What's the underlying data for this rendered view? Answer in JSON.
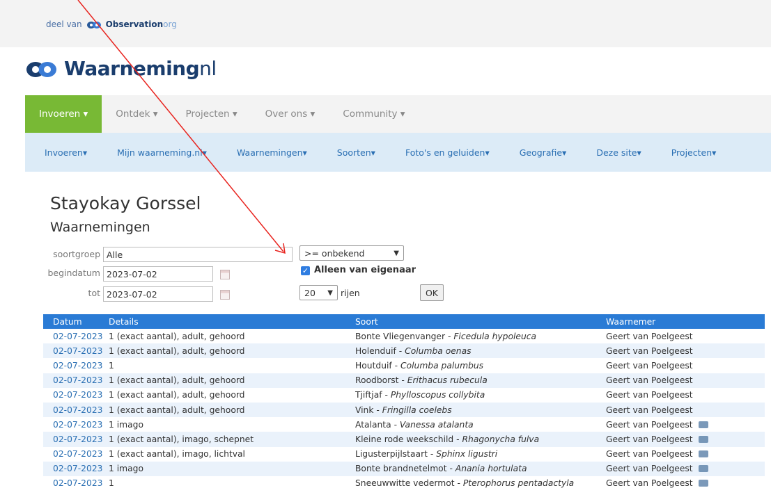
{
  "topbar": {
    "deel_van": "deel van",
    "brand": "Observation",
    "brand_suffix": "org"
  },
  "logo": {
    "name": "Waarneming",
    "suffix": "nl"
  },
  "nav_primary": [
    {
      "label": "Invoeren ▾",
      "active": true
    },
    {
      "label": "Ontdek ▾",
      "active": false
    },
    {
      "label": "Projecten ▾",
      "active": false
    },
    {
      "label": "Over ons ▾",
      "active": false
    },
    {
      "label": "Community ▾",
      "active": false
    }
  ],
  "nav_secondary": [
    "Invoeren▾",
    "Mijn waarneming.nl▾",
    "Waarnemingen▾",
    "Soorten▾",
    "Foto's en geluiden▾",
    "Geografie▾",
    "Deze site▾",
    "Projecten▾"
  ],
  "page": {
    "title": "Stayokay Gorssel",
    "subtitle": "Waarnemingen"
  },
  "filters": {
    "soortgroep_label": "soortgroep",
    "soortgroep_value": "Alle",
    "begindatum_label": "begindatum",
    "begindatum_value": "2023-07-02",
    "tot_label": "tot",
    "tot_value": "2023-07-02",
    "zekerheid_value": ">= onbekend",
    "eigenaar_label": "Alleen van eigenaar",
    "eigenaar_checked": true,
    "rows_value": "20",
    "rows_label": "rijen",
    "ok_label": "OK"
  },
  "table": {
    "headers": [
      "Datum",
      "Details",
      "Soort",
      "Waarnemer"
    ],
    "rows": [
      {
        "date": "02-07-2023",
        "details": "1 (exact aantal), adult, gehoord",
        "species": "Bonte Vliegenvanger",
        "scientific": "Ficedula hypoleuca",
        "observer": "Geert van Poelgeest",
        "photo": false
      },
      {
        "date": "02-07-2023",
        "details": "1 (exact aantal), adult, gehoord",
        "species": "Holenduif",
        "scientific": "Columba oenas",
        "observer": "Geert van Poelgeest",
        "photo": false
      },
      {
        "date": "02-07-2023",
        "details": "1",
        "species": "Houtduif",
        "scientific": "Columba palumbus",
        "observer": "Geert van Poelgeest",
        "photo": false
      },
      {
        "date": "02-07-2023",
        "details": "1 (exact aantal), adult, gehoord",
        "species": "Roodborst",
        "scientific": "Erithacus rubecula",
        "observer": "Geert van Poelgeest",
        "photo": false
      },
      {
        "date": "02-07-2023",
        "details": "1 (exact aantal), adult, gehoord",
        "species": "Tjiftjaf",
        "scientific": "Phylloscopus collybita",
        "observer": "Geert van Poelgeest",
        "photo": false
      },
      {
        "date": "02-07-2023",
        "details": "1 (exact aantal), adult, gehoord",
        "species": "Vink",
        "scientific": "Fringilla coelebs",
        "observer": "Geert van Poelgeest",
        "photo": false
      },
      {
        "date": "02-07-2023",
        "details": "1 imago",
        "species": "Atalanta",
        "scientific": "Vanessa atalanta",
        "observer": "Geert van Poelgeest",
        "photo": true
      },
      {
        "date": "02-07-2023",
        "details": "1 (exact aantal), imago, schepnet",
        "species": "Kleine rode weekschild",
        "scientific": "Rhagonycha fulva",
        "observer": "Geert van Poelgeest",
        "photo": true
      },
      {
        "date": "02-07-2023",
        "details": "1 (exact aantal), imago, lichtval",
        "species": "Ligusterpijlstaart",
        "scientific": "Sphinx ligustri",
        "observer": "Geert van Poelgeest",
        "photo": true
      },
      {
        "date": "02-07-2023",
        "details": "1 imago",
        "species": "Bonte brandnetelmot",
        "scientific": "Anania hortulata",
        "observer": "Geert van Poelgeest",
        "photo": true
      },
      {
        "date": "02-07-2023",
        "details": "1",
        "species": "Sneeuwwitte vedermot",
        "scientific": "Pterophorus pentadactyla",
        "observer": "Geert van Poelgeest",
        "photo": true
      }
    ]
  },
  "colors": {
    "accent_green": "#78b935",
    "table_header": "#2a7bd5",
    "link_blue": "#2a6fb3",
    "annotation_arrow": "#e8231e"
  }
}
